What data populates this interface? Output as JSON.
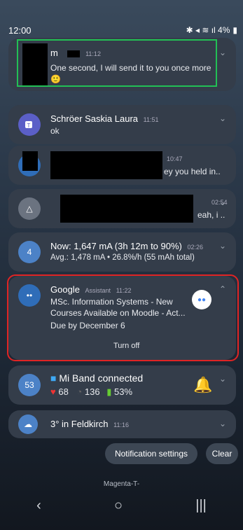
{
  "status": {
    "time": "12:00",
    "icons": "✱ ◂ ≋ ıl 4%",
    "battery": "4%"
  },
  "notifications": {
    "n1": {
      "name": "m",
      "time": "11:12",
      "text": "One second, I will send it to you once more",
      "emoji": "🙂"
    },
    "teams": {
      "name": "Schröer Saskia Laura",
      "time": "11:51",
      "text": "ok"
    },
    "n3": {
      "time": "10:47",
      "text": "ey you held in.."
    },
    "n4": {
      "time": "02:54",
      "text": "eah, i .."
    },
    "battery": {
      "title": "Now: 1,647 mA (3h 12m to 90%)",
      "time": "02:26",
      "text": "Avg.: 1,478 mA • 26.8%/h (55 mAh total)",
      "badge": "4"
    },
    "google": {
      "app": "Google",
      "sub": "Assistant",
      "time": "11:22",
      "line1": "MSc. Information Systems - New",
      "line2": "Courses Available on Moodle - Act...",
      "due": "Due by December 6",
      "action": "Turn off"
    },
    "miband": {
      "title": "Mi Band connected",
      "hr": "68",
      "steps": "136",
      "batt": "53%",
      "badge": "53"
    },
    "weather": {
      "text": "3° in Feldkirch",
      "time": "11:16"
    }
  },
  "actions": {
    "settings": "Notification settings",
    "clear": "Clear"
  },
  "carrier": "Magenta-T-",
  "nav": {
    "back": "‹",
    "home": "○",
    "recent": "|||"
  }
}
